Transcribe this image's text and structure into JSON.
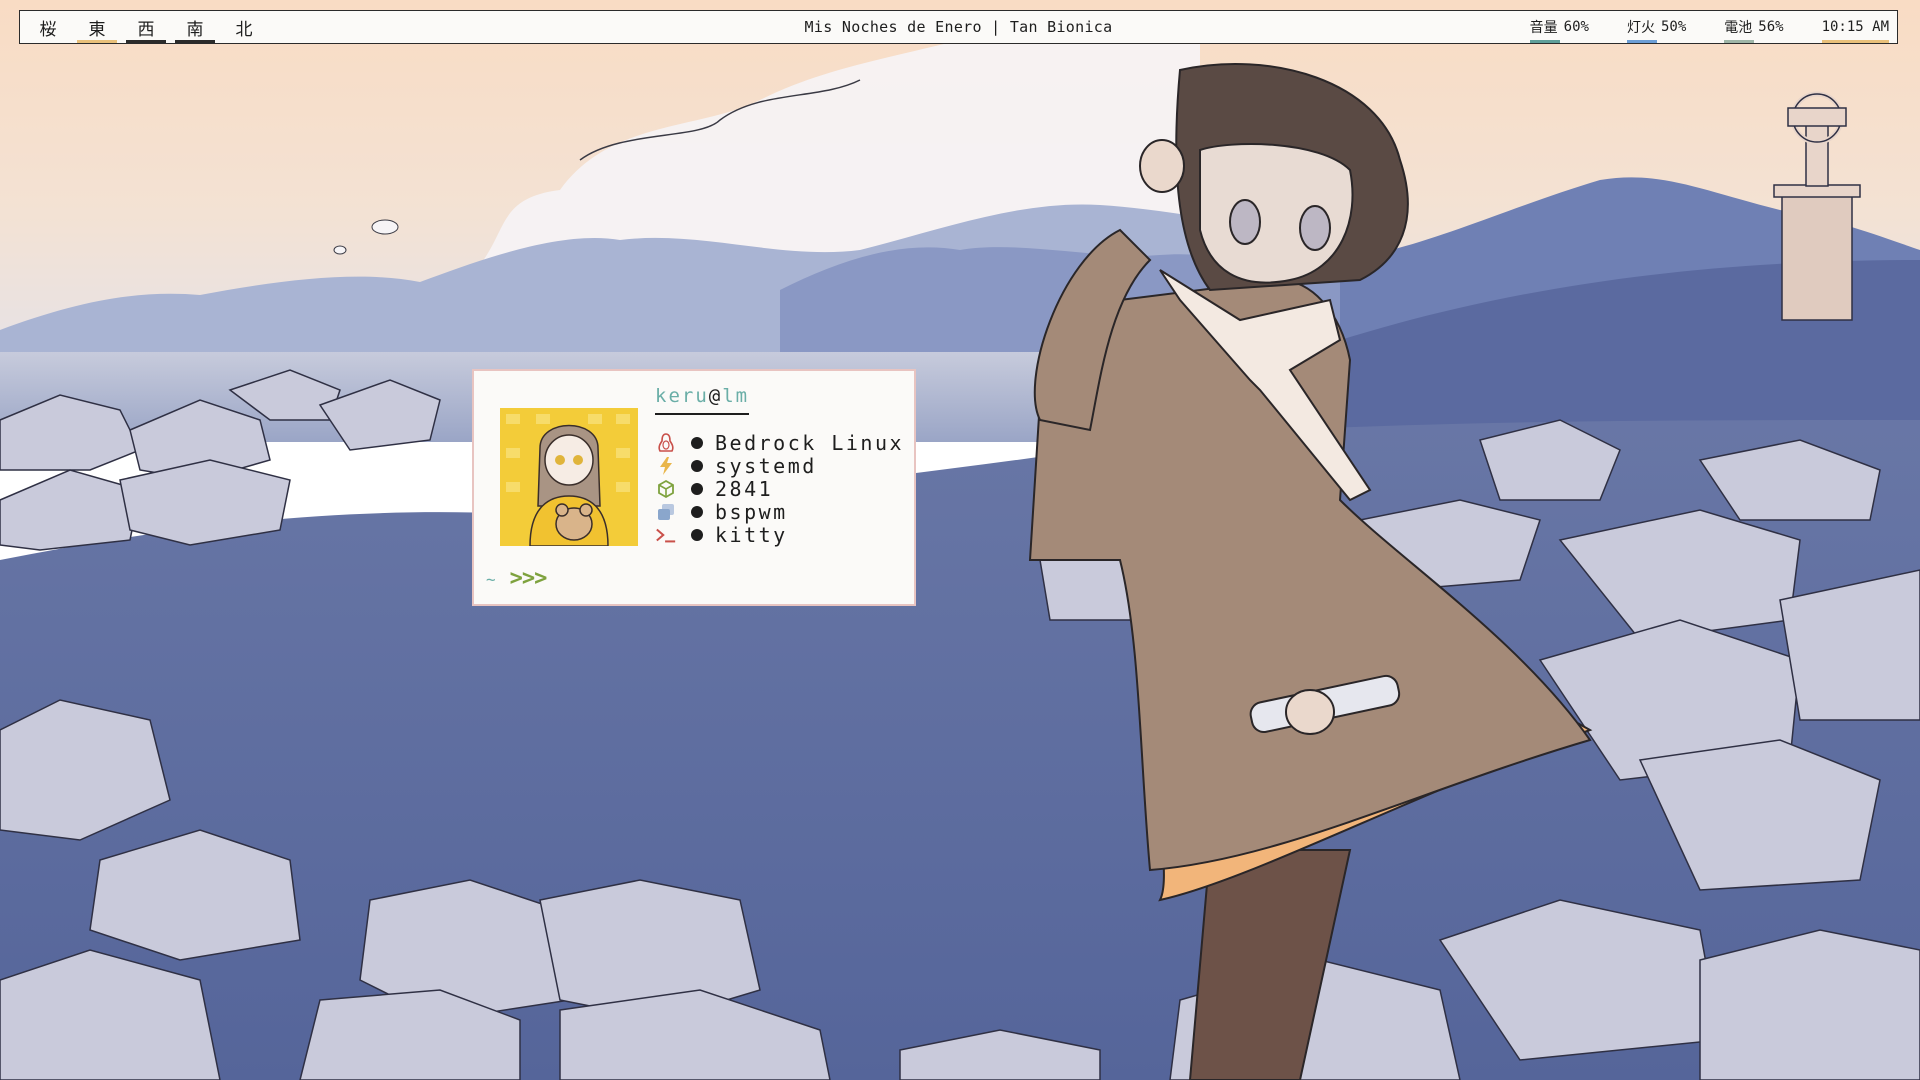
{
  "topbar": {
    "workspaces": [
      {
        "label": "桜",
        "state": "empty"
      },
      {
        "label": "東",
        "state": "occupied"
      },
      {
        "label": "西",
        "state": "active"
      },
      {
        "label": "南",
        "state": "active"
      },
      {
        "label": "北",
        "state": "empty"
      }
    ],
    "window_title": "Mis Noches de Enero | Tan Bionica",
    "modules": {
      "volume": {
        "label": "音量",
        "value": "60%",
        "color": "#5f9f9a"
      },
      "brightness": {
        "label": "灯火",
        "value": "50%",
        "color": "#6c9ed6"
      },
      "battery": {
        "label": "電池",
        "value": "56%",
        "color": "#9fb6a8"
      },
      "clock": {
        "value": "10:15 AM",
        "color": "#e9c07a"
      }
    }
  },
  "terminal": {
    "user": "keru",
    "at": "@",
    "host": "lm",
    "info": [
      {
        "icon": "linux-penguin-icon",
        "value": "Bedrock Linux",
        "color": "#c9504a"
      },
      {
        "icon": "lightning-icon",
        "value": "systemd",
        "color": "#e9b64a"
      },
      {
        "icon": "package-icon",
        "value": "2841",
        "color": "#7ea23e"
      },
      {
        "icon": "windows-stack-icon",
        "value": "bspwm",
        "color": "#8aa6cc"
      },
      {
        "icon": "terminal-prompt-icon",
        "value": "kitty",
        "color": "#c9504a"
      }
    ],
    "prompt_tilde": "~",
    "prompt_arrows": ">>>"
  },
  "colors": {
    "sky_top": "#f9ddc6",
    "meadow": "#5d6d9f",
    "rock": "#c6c8d8",
    "terminal_border": "#e8c4c1"
  }
}
